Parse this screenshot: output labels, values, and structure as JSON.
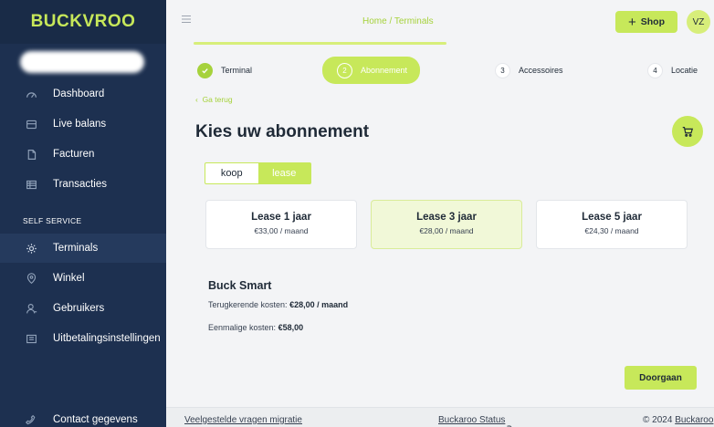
{
  "sidebar": {
    "logo": "BUCKVROO",
    "section_label": "SELF SERVICE",
    "items": [
      {
        "label": "Dashboard",
        "icon": "gauge-icon"
      },
      {
        "label": "Live balans",
        "icon": "card-icon"
      },
      {
        "label": "Facturen",
        "icon": "document-icon"
      },
      {
        "label": "Transacties",
        "icon": "list-icon"
      },
      {
        "label": "Terminals",
        "icon": "gear-icon"
      },
      {
        "label": "Winkel",
        "icon": "location-icon"
      },
      {
        "label": "Gebruikers",
        "icon": "user-icon"
      },
      {
        "label": "Uitbetalingsinstellingen",
        "icon": "settings-icon"
      },
      {
        "label": "Contact gegevens",
        "icon": "phone-icon"
      }
    ]
  },
  "header": {
    "breadcrumb": "Home / Terminals",
    "shop_label": "Shop",
    "avatar_initials": "VZ"
  },
  "stepper": {
    "steps": [
      {
        "number": "",
        "label": "Terminal",
        "state": "done"
      },
      {
        "number": "2",
        "label": "Abonnement",
        "state": "active"
      },
      {
        "number": "3",
        "label": "Accessoires",
        "state": "todo"
      },
      {
        "number": "4",
        "label": "Locatie",
        "state": "todo"
      }
    ]
  },
  "main": {
    "back_label": "Ga terug",
    "title": "Kies uw abonnement",
    "toggle": {
      "buy": "koop",
      "lease": "lease",
      "selected": "lease"
    },
    "plans": [
      {
        "name": "Lease 1 jaar",
        "price": "€33,00 / maand"
      },
      {
        "name": "Lease 3 jaar",
        "price": "€28,00 / maand"
      },
      {
        "name": "Lease 5 jaar",
        "price": "€24,30 / maand"
      }
    ],
    "selected_plan": "Lease 3 jaar",
    "product": {
      "name": "Buck Smart",
      "recurring_label": "Terugkerende kosten:",
      "recurring_value": "€28,00 / maand",
      "onetime_label": "Eenmalige kosten:",
      "onetime_value": "€58,00"
    },
    "continue_label": "Doorgaan"
  },
  "footer": {
    "faq": "Veelgestelde vragen migratie",
    "status": "Buckaroo Status",
    "copyright": "© 2024",
    "brand_link": "Buckaroo"
  },
  "colors": {
    "sidebar_bg": "#1d3050",
    "accent": "#c7e85a",
    "accent_text": "#a6d23c"
  }
}
